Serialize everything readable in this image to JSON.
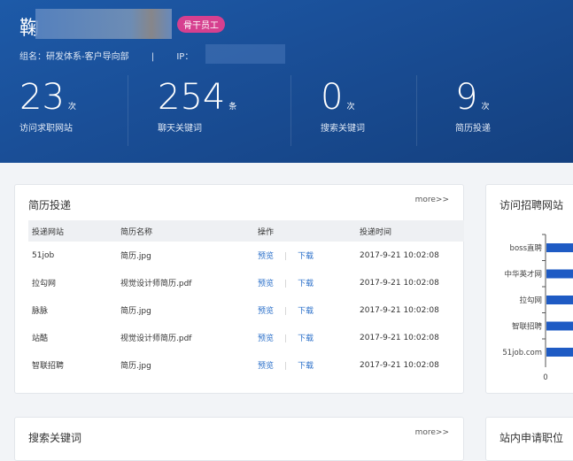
{
  "header": {
    "name_initial": "鞠",
    "badge": "骨干员工",
    "group": "组名：研发体系-客户导向部",
    "separator": "|",
    "ip_label": "IP："
  },
  "stats": [
    {
      "value": "23",
      "unit": "次",
      "label": "访问求职网站"
    },
    {
      "value": "254",
      "unit": "条",
      "label": "聊天关键词"
    },
    {
      "value": "0",
      "unit": "次",
      "label": "搜索关键词"
    },
    {
      "value": "9",
      "unit": "次",
      "label": "简历投递"
    }
  ],
  "resume": {
    "title": "简历投递",
    "more": "more>>",
    "columns": [
      "投递网站",
      "简历名称",
      "操作",
      "投递时间"
    ],
    "preview": "预览",
    "download": "下载",
    "rows": [
      {
        "site": "51job",
        "file": "简历.jpg",
        "time": "2017-9-21 10:02:08"
      },
      {
        "site": "拉勾网",
        "file": "视觉设计师简历.pdf",
        "time": "2017-9-21 10:02:08"
      },
      {
        "site": "脉脉",
        "file": "简历.jpg",
        "time": "2017-9-21 10:02:08"
      },
      {
        "site": "站酷",
        "file": "视觉设计师简历.pdf",
        "time": "2017-9-21 10:02:08"
      },
      {
        "site": "智联招聘",
        "file": "简历.jpg",
        "time": "2017-9-21 10:02:08"
      }
    ]
  },
  "sites": {
    "title": "访问招聘网站",
    "chart_data": {
      "type": "bar",
      "categories": [
        "boss直聘",
        "中华英才网",
        "拉勾网",
        "智联招聘",
        "51job.com"
      ],
      "x_tick": "0",
      "bar_color": "#1f5bc4"
    }
  },
  "search": {
    "title": "搜索关键词",
    "more": "more>>"
  },
  "apply": {
    "title": "站内申请职位"
  }
}
